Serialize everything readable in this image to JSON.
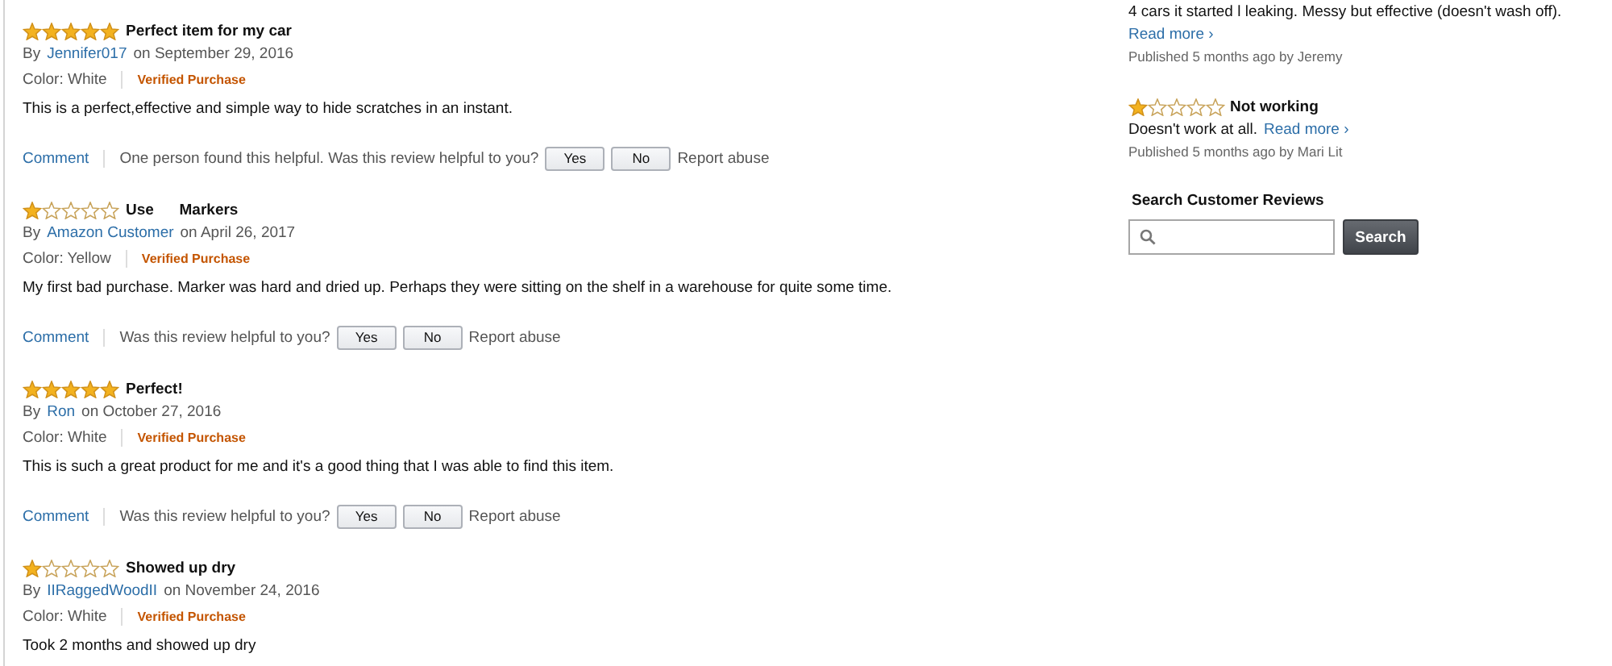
{
  "reviews": [
    {
      "stars": 5,
      "title": "Perfect item for my car",
      "by": "By",
      "author": "Jennifer017",
      "date": "on September 29, 2016",
      "variant": "Color: White",
      "badge": "Verified Purchase",
      "body": "This is a perfect,effective and simple way to hide scratches in an instant.",
      "comment": "Comment",
      "helpful": "One person found this helpful. Was this review helpful to you?",
      "yes": "Yes",
      "no": "No",
      "report": "Report abuse"
    },
    {
      "stars": 1,
      "title": "Use      Markers",
      "by": "By",
      "author": "Amazon Customer",
      "date": "on April 26, 2017",
      "variant": "Color: Yellow",
      "badge": "Verified Purchase",
      "body": "My first bad purchase. Marker was hard and dried up. Perhaps they were sitting on the shelf in a warehouse for quite some time.",
      "comment": "Comment",
      "helpful": "Was this review helpful to you?",
      "yes": "Yes",
      "no": "No",
      "report": "Report abuse"
    },
    {
      "stars": 5,
      "title": "Perfect!",
      "by": "By",
      "author": "Ron",
      "date": "on October 27, 2016",
      "variant": "Color: White",
      "badge": "Verified Purchase",
      "body": "This is such a great product for me and it's a good thing that I was able to find this item.",
      "comment": "Comment",
      "helpful": "Was this review helpful to you?",
      "yes": "Yes",
      "no": "No",
      "report": "Report abuse"
    },
    {
      "stars": 1,
      "title": "Showed up dry",
      "by": "By",
      "author": "IIRaggedWoodII",
      "date": "on November 24, 2016",
      "variant": "Color: White",
      "badge": "Verified Purchase",
      "body": "Took 2 months and showed up dry"
    }
  ],
  "sidebar": {
    "snippets": [
      {
        "body": "4 cars it started l leaking. Messy but effective (doesn't wash off).",
        "read_more": "Read more ›",
        "published": "Published 5 months ago by Jeremy"
      },
      {
        "stars": 1,
        "title": "Not working",
        "body": "Doesn't work at all.",
        "read_more": "Read more ›",
        "published": "Published 5 months ago by Mari Lit"
      }
    ],
    "search": {
      "heading": "Search Customer Reviews",
      "button": "Search"
    }
  }
}
